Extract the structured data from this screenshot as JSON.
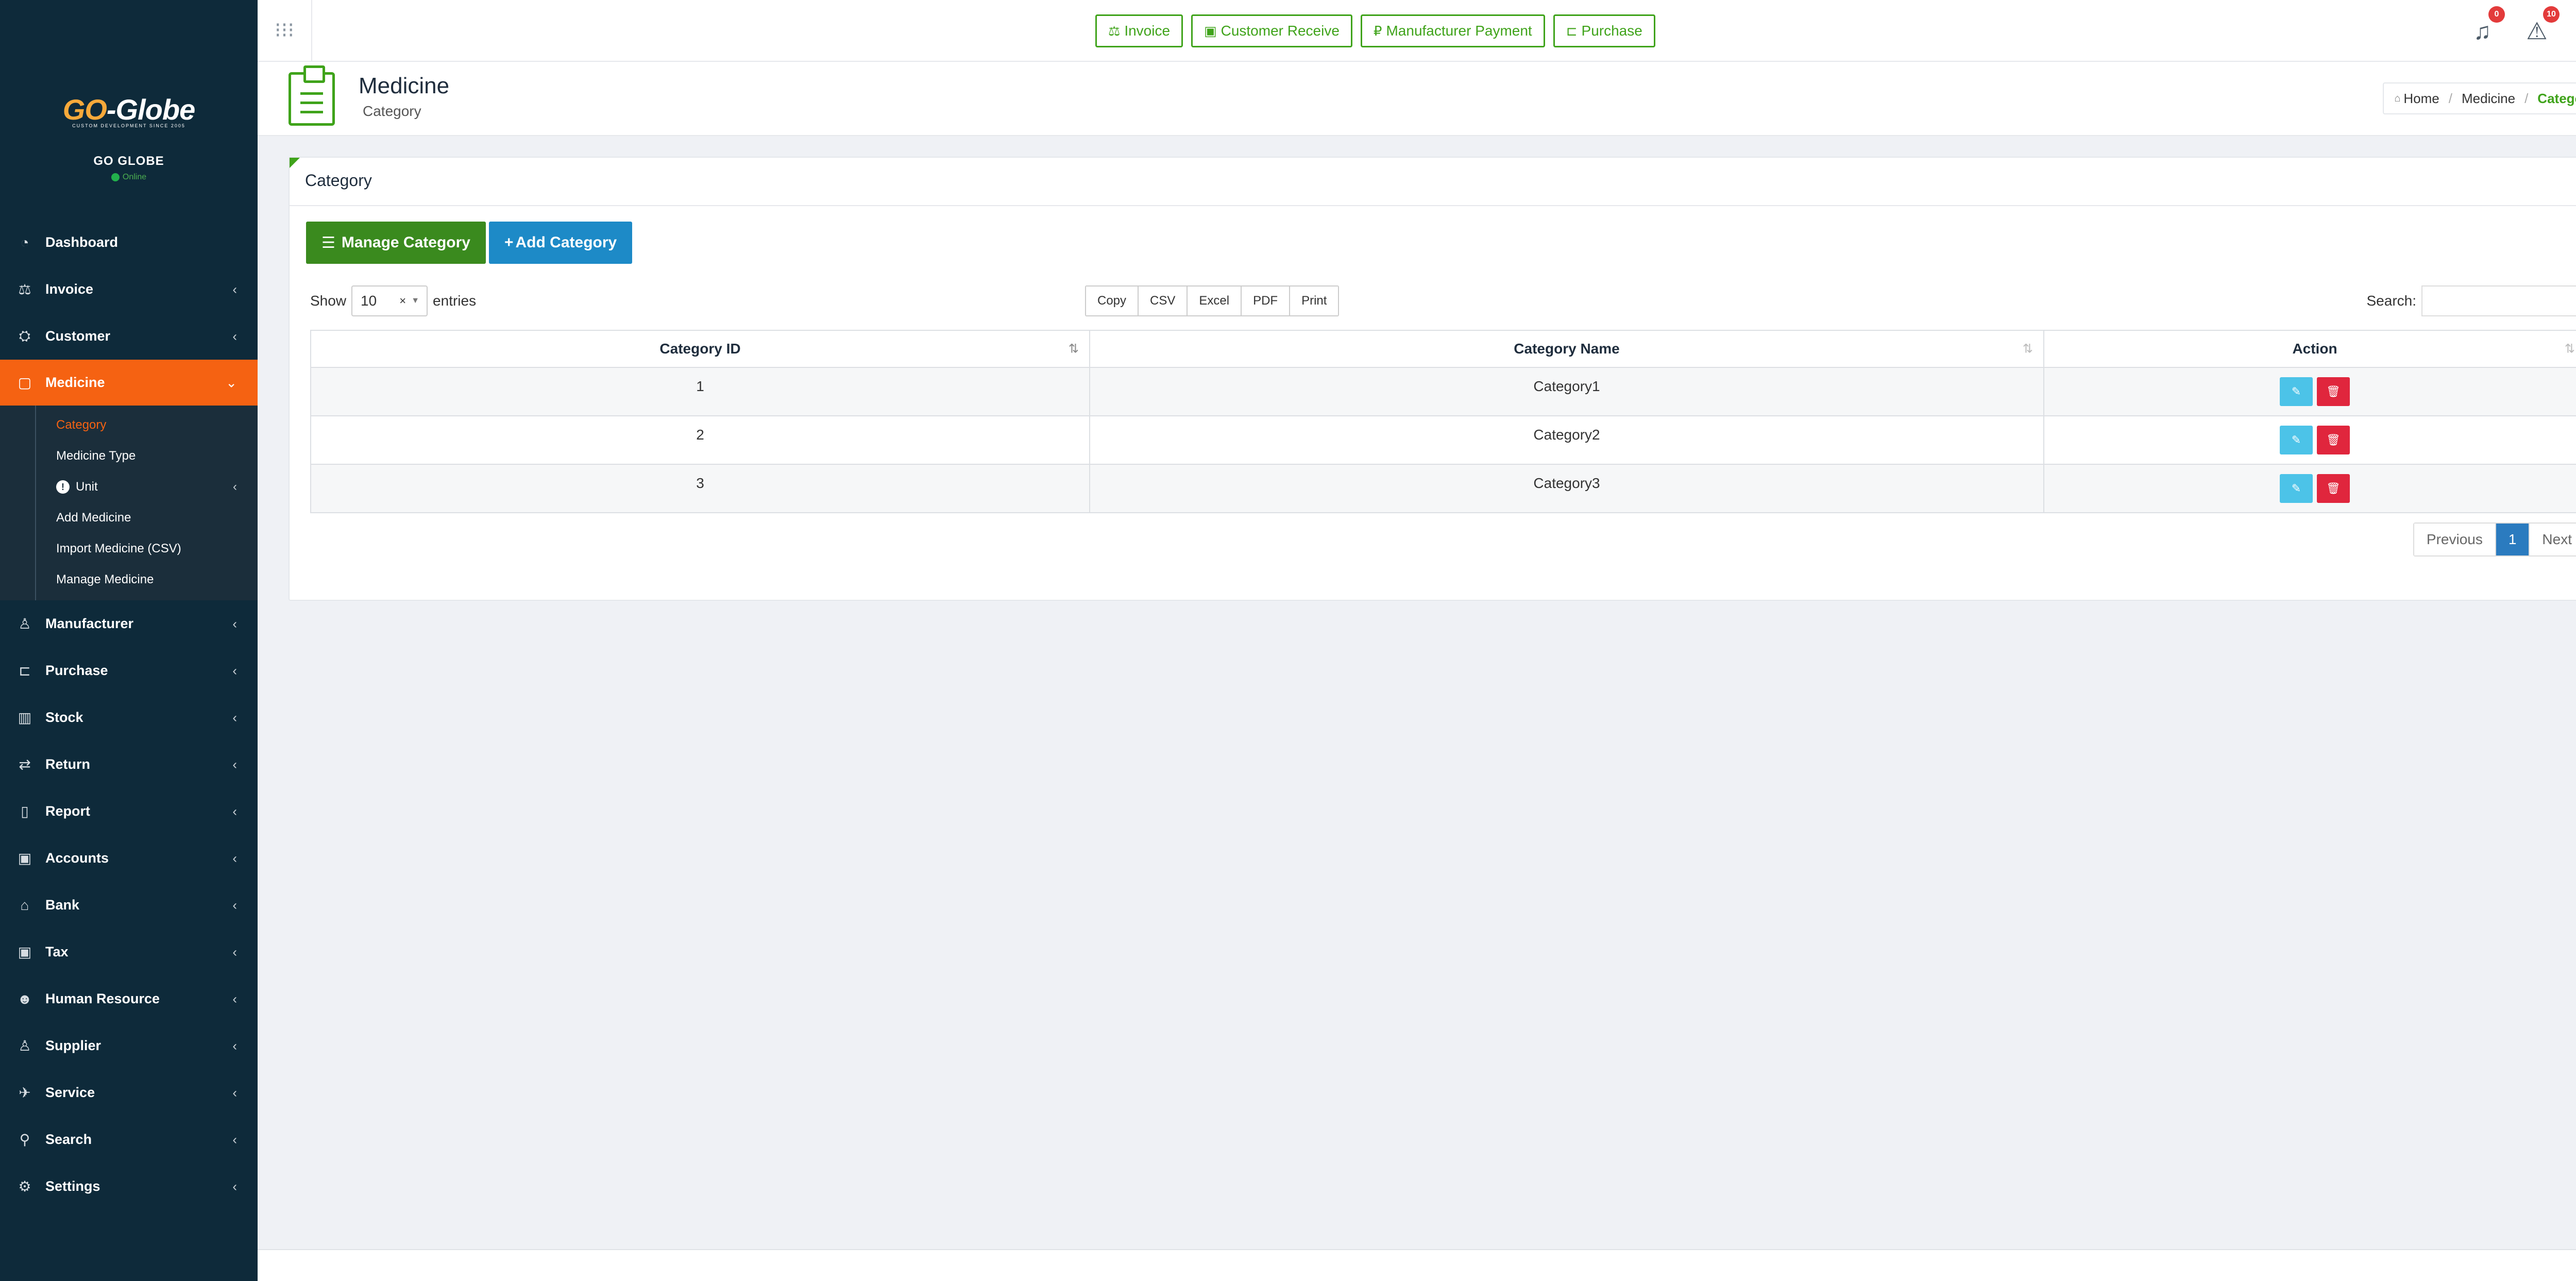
{
  "brand": {
    "logo": "GO-Globe",
    "tagline": "CUSTOM DEVELOPMENT SINCE 2005",
    "company": "GO GLOBE",
    "status": "Online"
  },
  "sidebar": {
    "items": [
      {
        "label": "Dashboard",
        "icon": "dashboard-icon"
      },
      {
        "label": "Invoice",
        "icon": "balance-scale-icon"
      },
      {
        "label": "Customer",
        "icon": "handshake-icon"
      },
      {
        "label": "Medicine",
        "icon": "shopping-bag-icon"
      },
      {
        "label": "Manufacturer",
        "icon": "user-icon"
      },
      {
        "label": "Purchase",
        "icon": "cart-icon"
      },
      {
        "label": "Stock",
        "icon": "bar-chart-icon"
      },
      {
        "label": "Return",
        "icon": "exchange-icon"
      },
      {
        "label": "Report",
        "icon": "book-icon"
      },
      {
        "label": "Accounts",
        "icon": "money-icon"
      },
      {
        "label": "Bank",
        "icon": "bank-icon"
      },
      {
        "label": "Tax",
        "icon": "money-icon"
      },
      {
        "label": "Human Resource",
        "icon": "users-icon"
      },
      {
        "label": "Supplier",
        "icon": "user-icon"
      },
      {
        "label": "Service",
        "icon": "service-icon"
      },
      {
        "label": "Search",
        "icon": "search-icon"
      },
      {
        "label": "Settings",
        "icon": "gear-icon"
      }
    ],
    "submenu": [
      "Category",
      "Medicine Type",
      "Unit",
      "Add Medicine",
      "Import Medicine (CSV)",
      "Manage Medicine"
    ]
  },
  "topbar": {
    "quick": [
      "Invoice",
      "Customer Receive",
      "Manufacturer Payment",
      "Purchase"
    ],
    "notification_count": "0",
    "alert_count": "10"
  },
  "header": {
    "title": "Medicine",
    "subtitle": "Category",
    "breadcrumb": [
      "Home",
      "Medicine",
      "Category"
    ]
  },
  "card": {
    "title": "Category",
    "manage_label": "Manage Category",
    "add_label": "Add Category",
    "show_label": "Show",
    "entries_value": "10",
    "entries_label": "entries",
    "exports": [
      "Copy",
      "CSV",
      "Excel",
      "PDF",
      "Print"
    ],
    "search_label": "Search:",
    "columns": [
      "Category ID",
      "Category Name",
      "Action"
    ],
    "rows": [
      {
        "id": "1",
        "name": "Category1"
      },
      {
        "id": "2",
        "name": "Category2"
      },
      {
        "id": "3",
        "name": "Category3"
      }
    ],
    "pager": {
      "prev": "Previous",
      "page": "1",
      "next": "Next"
    }
  },
  "colors": {
    "sidebar": "#0e2a3a",
    "accent": "#f56212",
    "green": "#3fa31a",
    "blue": "#1d8ac7"
  }
}
